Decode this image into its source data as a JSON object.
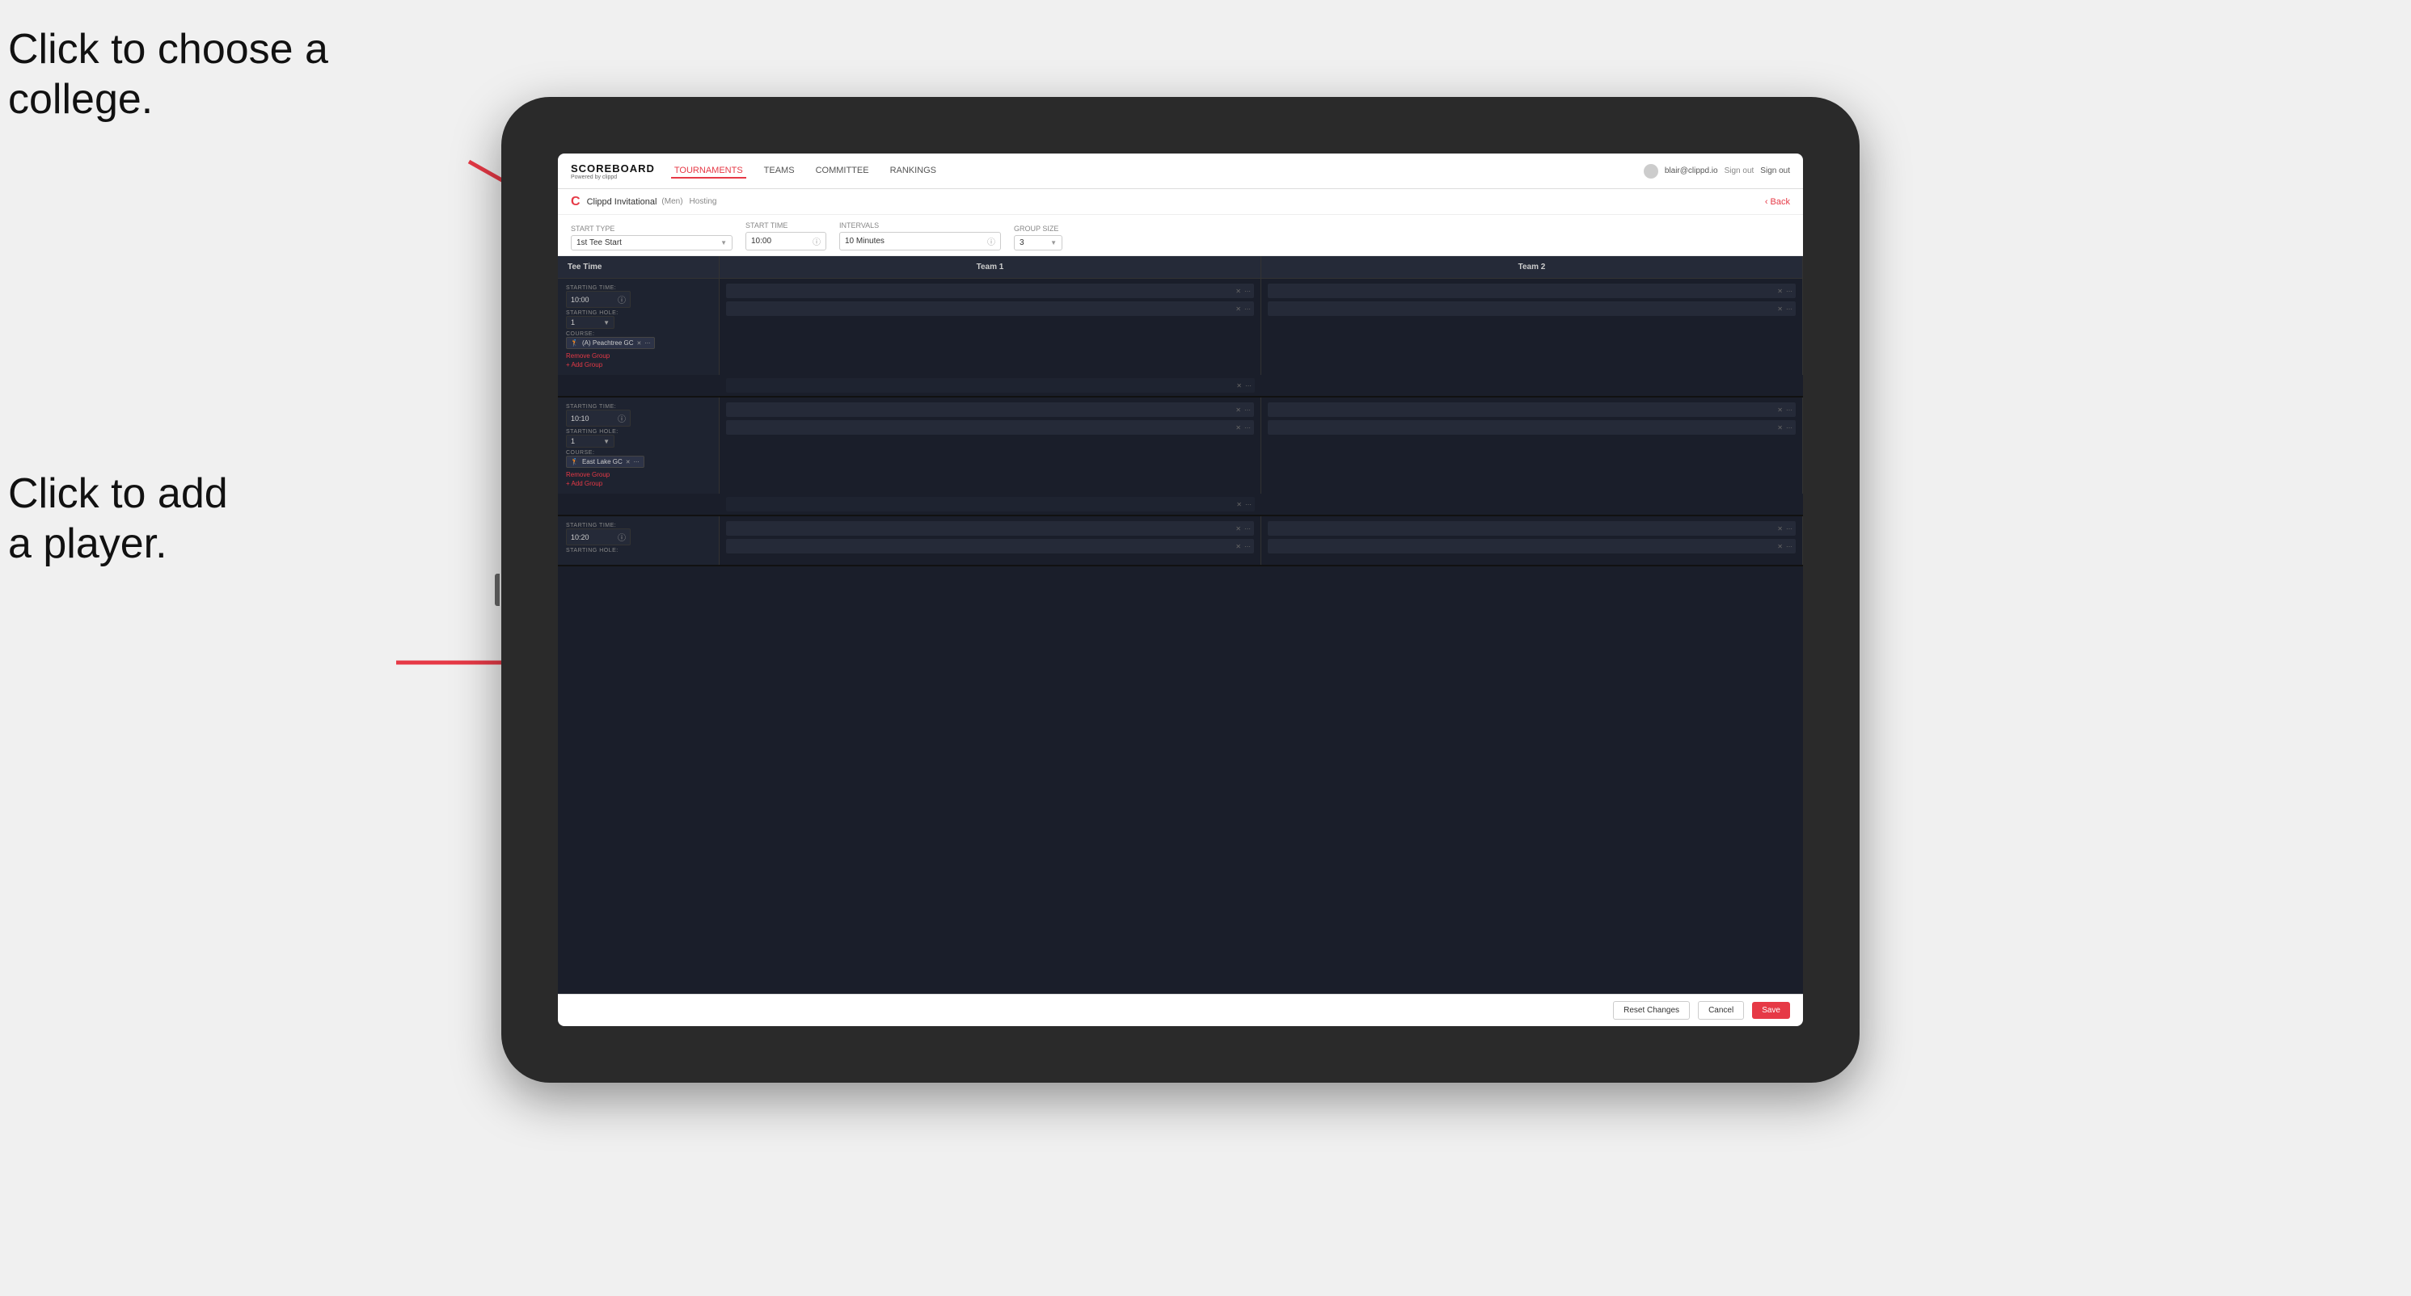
{
  "annotations": {
    "text1_line1": "Click to choose a",
    "text1_line2": "college.",
    "text2_line1": "Click to add",
    "text2_line2": "a player."
  },
  "navbar": {
    "brand": "SCOREBOARD",
    "brand_sub": "Powered by clippd",
    "links": [
      "TOURNAMENTS",
      "TEAMS",
      "COMMITTEE",
      "RANKINGS"
    ],
    "active_link": "TOURNAMENTS",
    "user_email": "blair@clippd.io",
    "sign_out": "Sign out"
  },
  "sub_header": {
    "logo": "C",
    "title": "Clippd Invitational",
    "badge": "(Men)",
    "hosting": "Hosting",
    "back": "‹ Back"
  },
  "settings": {
    "start_type_label": "Start Type",
    "start_type_value": "1st Tee Start",
    "start_time_label": "Start Time",
    "start_time_value": "10:00",
    "intervals_label": "Intervals",
    "intervals_value": "10 Minutes",
    "group_size_label": "Group Size",
    "group_size_value": "3"
  },
  "table_header": {
    "col1": "Tee Time",
    "col2": "Team 1",
    "col3": "Team 2"
  },
  "groups": [
    {
      "starting_time": "10:00",
      "starting_hole": "1",
      "course": "(A) Peachtree GC",
      "remove_group": "Remove Group",
      "add_group": "+ Add Group",
      "team1_slots": 2,
      "team2_slots": 2
    },
    {
      "starting_time": "10:10",
      "starting_hole": "1",
      "course": "East Lake GC",
      "remove_group": "Remove Group",
      "add_group": "+ Add Group",
      "team1_slots": 2,
      "team2_slots": 2
    },
    {
      "starting_time": "10:20",
      "starting_hole": "",
      "course": "",
      "remove_group": "",
      "add_group": "",
      "team1_slots": 2,
      "team2_slots": 2
    }
  ],
  "footer": {
    "reset_label": "Reset Changes",
    "cancel_label": "Cancel",
    "save_label": "Save"
  }
}
